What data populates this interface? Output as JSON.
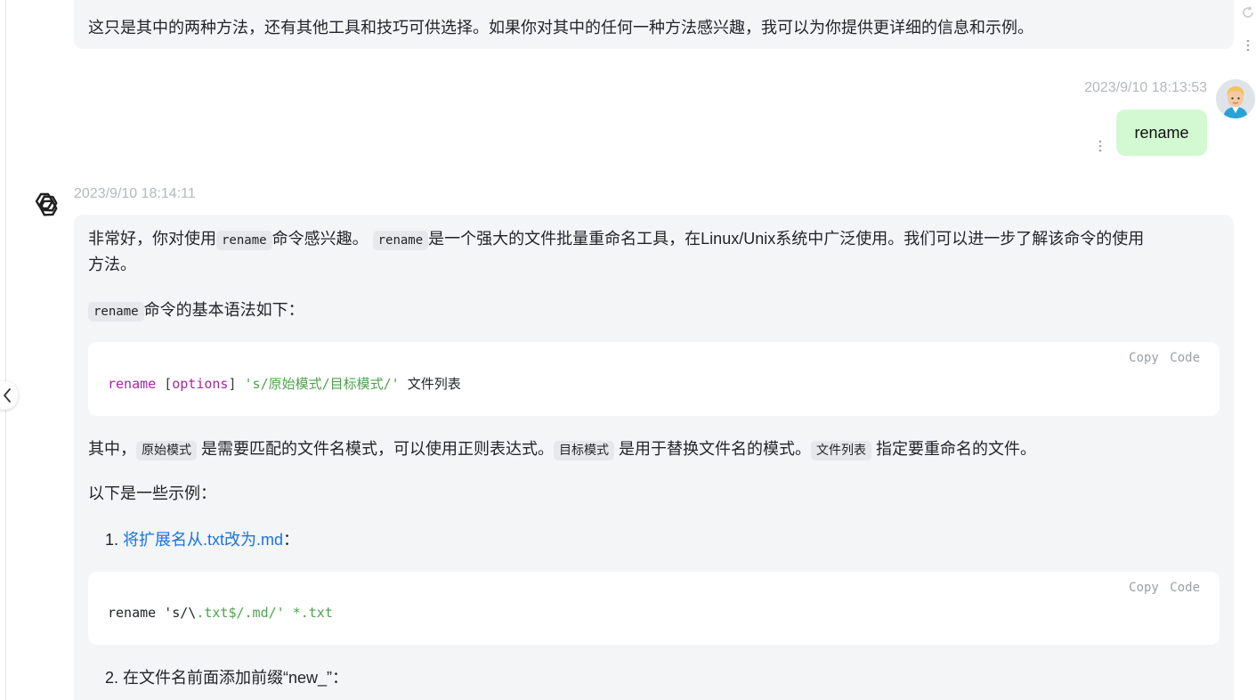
{
  "top_message": {
    "text": "这只是其中的两种方法，还有其他工具和技巧可供选择。如果你对其中的任何一种方法感兴趣，我可以为你提供更详细的信息和示例。"
  },
  "user_message": {
    "timestamp": "2023/9/10 18:13:53",
    "text": "rename"
  },
  "ai_message": {
    "timestamp": "2023/9/10 18:14:11",
    "p1_a": "非常好，你对使用",
    "p1_code1": "rename",
    "p1_b": "命令感兴趣。",
    "p1_code2": "rename",
    "p1_c": "是一个强大的文件批量重命名工具，在Linux/Unix系统中广泛使用。我们可以进一步了解该命令的使用",
    "p1_d": "方法。",
    "p2_code": "rename",
    "p2_text": "命令的基本语法如下：",
    "code1": {
      "copy_label": "Copy Code",
      "cmd": "rename",
      "opt": "[options]",
      "pattern": "'s/原始模式/目标模式/'",
      "files": "文件列表"
    },
    "p3_a": "其中，",
    "p3_code1": "原始模式",
    "p3_b": "是需要匹配的文件名模式，可以使用正则表达式。",
    "p3_code2": "目标模式",
    "p3_c": "是用于替换文件名的模式。",
    "p3_code3": "文件列表",
    "p3_d": "指定要重命名的文件。",
    "p4": "以下是一些示例：",
    "list": [
      {
        "num": "1.",
        "text": "将扩展名从.txt改为.md",
        "suffix": "："
      },
      {
        "num": "2.",
        "text": "在文件名前面添加前缀“new_”："
      }
    ],
    "code2": {
      "copy_label": "Copy Code",
      "part1": "rename 's/\\",
      "part2": ".txt$",
      "part3": "/.md/' *",
      "part4": ".txt"
    }
  },
  "icons": [
    "refresh-icon",
    "more-vertical-icon",
    "chevron-left-icon",
    "openai-logo-icon",
    "user-avatar"
  ]
}
